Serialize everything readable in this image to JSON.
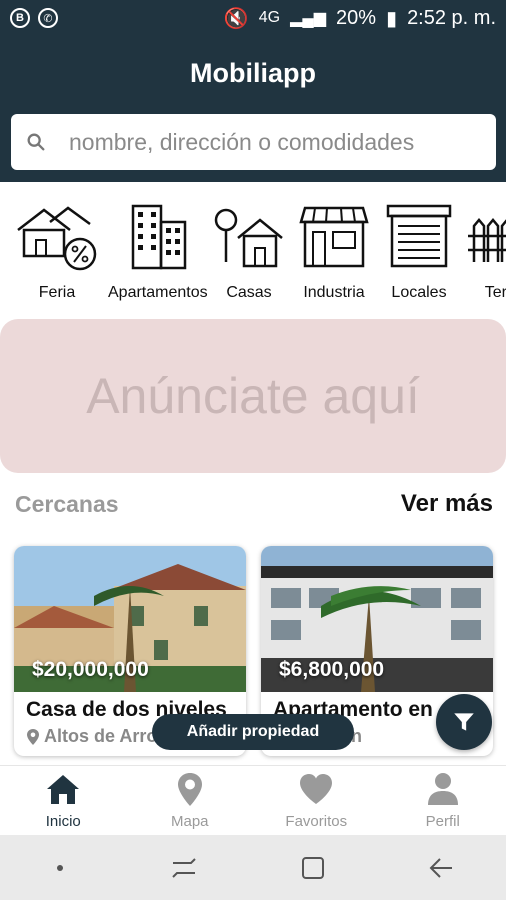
{
  "status_bar": {
    "time": "2:52 p. m.",
    "battery": "20%",
    "network": "4G"
  },
  "app": {
    "title": "Mobiliapp"
  },
  "search": {
    "placeholder": "nombre, dirección o comodidades"
  },
  "categories": [
    {
      "label": "Feria",
      "icon": "fair-house-percent-icon"
    },
    {
      "label": "Apartamentos",
      "icon": "apartments-building-icon"
    },
    {
      "label": "Casas",
      "icon": "house-tree-icon"
    },
    {
      "label": "Industria",
      "icon": "industry-store-icon"
    },
    {
      "label": "Locales",
      "icon": "commercial-garage-icon"
    },
    {
      "label": "Terre",
      "icon": "fence-icon"
    }
  ],
  "ad": {
    "text": "Anúnciate aquí"
  },
  "nearby": {
    "title": "Cercanas",
    "see_more": "Ver más",
    "cards": [
      {
        "price": "$20,000,000",
        "title": "Casa de dos niveles",
        "location": "Altos de Arro"
      },
      {
        "price": "$6,800,000",
        "title": "Apartamento en",
        "location": "n"
      }
    ]
  },
  "toast": "Añadir propiedad",
  "bottom_nav": [
    {
      "label": "Inicio",
      "icon": "home-icon",
      "active": true
    },
    {
      "label": "Mapa",
      "icon": "map-pin-icon",
      "active": false
    },
    {
      "label": "Favoritos",
      "icon": "heart-icon",
      "active": false
    },
    {
      "label": "Perfil",
      "icon": "profile-icon",
      "active": false
    }
  ],
  "colors": {
    "primary": "#203440",
    "ad_background": "#ecd9d9",
    "muted": "#9a9a9a"
  }
}
